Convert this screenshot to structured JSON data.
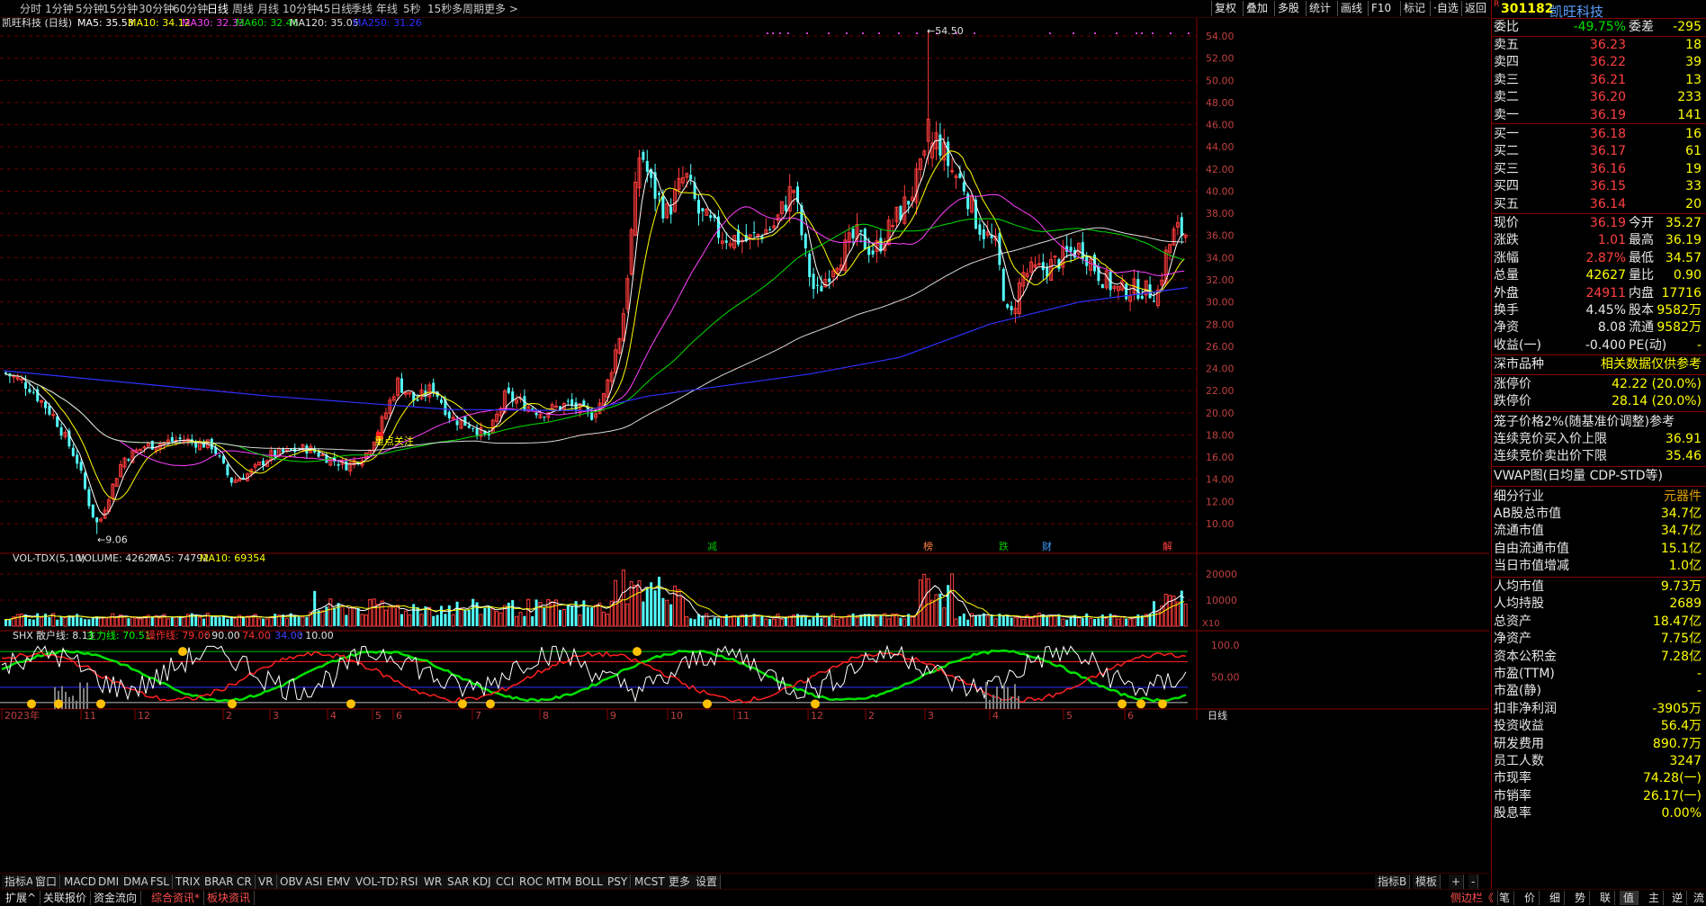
{
  "toolbar": {
    "periods": [
      "分时",
      "1分钟",
      "5分钟",
      "15分钟",
      "30分钟",
      "60分钟",
      "日线",
      "周线",
      "月线",
      "10分钟",
      "45日线",
      "季线",
      "年线",
      "5秒",
      "15秒",
      "多周期",
      "更多 >"
    ],
    "selected_period": "日线",
    "right_buttons": [
      "复权",
      "叠加",
      "多股",
      "统计",
      "画线",
      "F10",
      "标记",
      "·自选",
      "返回"
    ]
  },
  "chart": {
    "title": "凯旺科技 (日线)",
    "ma_legend": [
      {
        "label": "MA5: 35.53",
        "color": "#ffffff"
      },
      {
        "label": "MA10: 34.12",
        "color": "#ffff00"
      },
      {
        "label": "MA30: 32.33",
        "color": "#ff40ff"
      },
      {
        "label": "MA60: 32.46",
        "color": "#00e000"
      },
      {
        "label": "MA120: 35.05",
        "color": "#e0e0e0"
      },
      {
        "label": "MA250: 31.26",
        "color": "#3030ff"
      }
    ],
    "price_axis": [
      "54.00",
      "52.00",
      "50.00",
      "48.00",
      "46.00",
      "44.00",
      "42.00",
      "40.00",
      "38.00",
      "36.00",
      "34.00",
      "32.00",
      "30.00",
      "28.00",
      "26.00",
      "24.00",
      "22.00",
      "20.00",
      "18.00",
      "16.00",
      "14.00",
      "12.00",
      "10.00"
    ],
    "high_mark": "54.50",
    "low_mark": "9.06",
    "event_markers": [
      "减",
      "榜",
      "跌",
      "财",
      "解"
    ],
    "annotation": "重点关注",
    "volume_legend": {
      "name": "VOL-TDX(5,10)",
      "volume": "VOLUME: 42627",
      "ma5": "MA5: 74792",
      "ma10": "MA10: 69354"
    },
    "volume_axis": [
      "20000",
      "10000",
      "X10"
    ],
    "shx_legend": {
      "name": "SHX",
      "retail": "散户线: 8.13",
      "main": "主力线: 70.51",
      "op": "操作线: 79.00",
      "v90": ": 90.00",
      "v74": ": 74.00",
      "v34": ": 34.00",
      "v10": ": 10.00"
    },
    "shx_axis": [
      "100.0",
      "50.00"
    ],
    "date_axis": [
      "2023年",
      "11",
      "12",
      "2",
      "3",
      "4",
      "5",
      "6",
      "7",
      "8",
      "9",
      "10",
      "11",
      "12",
      "2",
      "3",
      "4",
      "5",
      "6"
    ]
  },
  "bottom_tabs": [
    "指标A",
    "窗口",
    "MACD",
    "DMI",
    "DMA",
    "FSL",
    "TRIX",
    "BRAR",
    "CR",
    "VR",
    "OBV",
    "ASI",
    "EMV",
    "VOL-TDX",
    "RSI",
    "WR",
    "SAR",
    "KDJ",
    "CCI",
    "ROC",
    "MTM",
    "BOLL",
    "PSY",
    "MCST",
    "更多",
    "设置"
  ],
  "bottom_right": [
    "指标B",
    "模板",
    "+",
    "-"
  ],
  "bottom_bar": {
    "left": [
      "扩展^",
      "关联报价",
      "资金流向",
      "综合资讯*",
      "板块资讯"
    ],
    "right": [
      "侧边栏《",
      "笔",
      "价",
      "细",
      "势",
      "联",
      "值",
      "主",
      "逆",
      "流"
    ],
    "day_label": "日线"
  },
  "stock": {
    "code": "301182",
    "name": "凯旺科技",
    "weibi_label": "委比",
    "weibi": "-49.75%",
    "weicha_label": "委差",
    "weicha": "-295",
    "asks": [
      {
        "label": "卖五",
        "price": "36.23",
        "vol": "18"
      },
      {
        "label": "卖四",
        "price": "36.22",
        "vol": "39"
      },
      {
        "label": "卖三",
        "price": "36.21",
        "vol": "13"
      },
      {
        "label": "卖二",
        "price": "36.20",
        "vol": "233"
      },
      {
        "label": "卖一",
        "price": "36.19",
        "vol": "141"
      }
    ],
    "bids": [
      {
        "label": "买一",
        "price": "36.18",
        "vol": "16"
      },
      {
        "label": "买二",
        "price": "36.17",
        "vol": "61"
      },
      {
        "label": "买三",
        "price": "36.16",
        "vol": "19"
      },
      {
        "label": "买四",
        "price": "36.15",
        "vol": "33"
      },
      {
        "label": "买五",
        "price": "36.14",
        "vol": "20"
      }
    ],
    "quote": [
      {
        "l1": "现价",
        "v1": "36.19",
        "c1": "red",
        "l2": "今开",
        "v2": "35.27",
        "c2": "red"
      },
      {
        "l1": "涨跌",
        "v1": "1.01",
        "c1": "red",
        "l2": "最高",
        "v2": "36.19",
        "c2": "red"
      },
      {
        "l1": "涨幅",
        "v1": "2.87%",
        "c1": "red",
        "l2": "最低",
        "v2": "34.57",
        "c2": "grn"
      },
      {
        "l1": "总量",
        "v1": "42627",
        "c1": "yel",
        "l2": "量比",
        "v2": "0.90",
        "c2": "yel"
      },
      {
        "l1": "外盘",
        "v1": "24911",
        "c1": "red",
        "l2": "内盘",
        "v2": "17716",
        "c2": "grn"
      },
      {
        "l1": "换手",
        "v1": "4.45%",
        "c1": "wht",
        "l2": "股本",
        "v2": "9582万",
        "c2": "wht"
      },
      {
        "l1": "净资",
        "v1": "8.08",
        "c1": "wht",
        "l2": "流通",
        "v2": "9582万",
        "c2": "wht"
      },
      {
        "l1": "收益(一)",
        "v1": "-0.400",
        "c1": "wht",
        "l2": "PE(动)",
        "v2": "-",
        "c2": "wht"
      }
    ],
    "market_label": "深市品种",
    "market_note": "相关数据仅供参考",
    "limit_up_label": "涨停价",
    "limit_up": "42.22 (20.0%)",
    "limit_down_label": "跌停价",
    "limit_down": "28.14 (20.0%)",
    "cage_label": "笼子价格2%(随基准价调整)参考",
    "bid_upper_label": "连续竞价买入价上限",
    "bid_upper": "36.91",
    "ask_lower_label": "连续竞价卖出价下限",
    "ask_lower": "35.46",
    "vwap_label": "VWAP图(日均量 CDP-STD等)",
    "industry_label": "细分行业",
    "industry": "元器件",
    "fundamentals": [
      {
        "l": "AB股总市值",
        "v": "34.7亿"
      },
      {
        "l": "流通市值",
        "v": "34.7亿"
      },
      {
        "l": "自由流通市值",
        "v": "15.1亿"
      },
      {
        "l": "当日市值增减",
        "v": "1.0亿"
      }
    ],
    "fundamentals2": [
      {
        "l": "人均市值",
        "v": "9.73万"
      },
      {
        "l": "人均持股",
        "v": "2689"
      },
      {
        "l": "总资产",
        "v": "18.47亿"
      },
      {
        "l": "净资产",
        "v": "7.75亿"
      },
      {
        "l": "资本公积金",
        "v": "7.28亿"
      },
      {
        "l": "市盈(TTM)",
        "v": "-"
      },
      {
        "l": "市盈(静)",
        "v": "-"
      },
      {
        "l": "扣非净利润",
        "v": "-3905万"
      },
      {
        "l": "投资收益",
        "v": "56.4万"
      },
      {
        "l": "研发费用",
        "v": "890.7万"
      },
      {
        "l": "员工人数",
        "v": "3247"
      },
      {
        "l": "市现率",
        "v": "74.28(一)"
      },
      {
        "l": "市销率",
        "v": "26.17(一)"
      },
      {
        "l": "股息率",
        "v": "0.00%"
      }
    ]
  }
}
